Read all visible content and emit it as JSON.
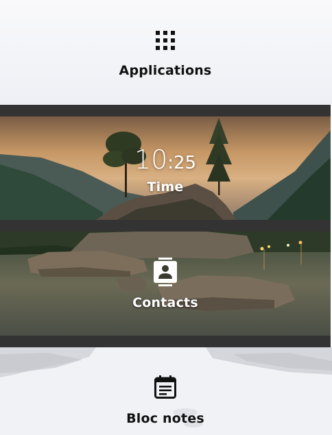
{
  "tiles": {
    "applications": {
      "label": "Applications",
      "icon": "apps-grid-icon"
    },
    "time": {
      "label": "Time",
      "hours": "10",
      "separator": ":",
      "minutes": "25"
    },
    "contacts": {
      "label": "Contacts",
      "icon": "contact-card-icon"
    },
    "notes": {
      "label": "Bloc notes",
      "icon": "notepad-icon"
    }
  },
  "colors": {
    "separator": "#333333",
    "light_label": "#111111",
    "dark_label": "#ffffff"
  }
}
